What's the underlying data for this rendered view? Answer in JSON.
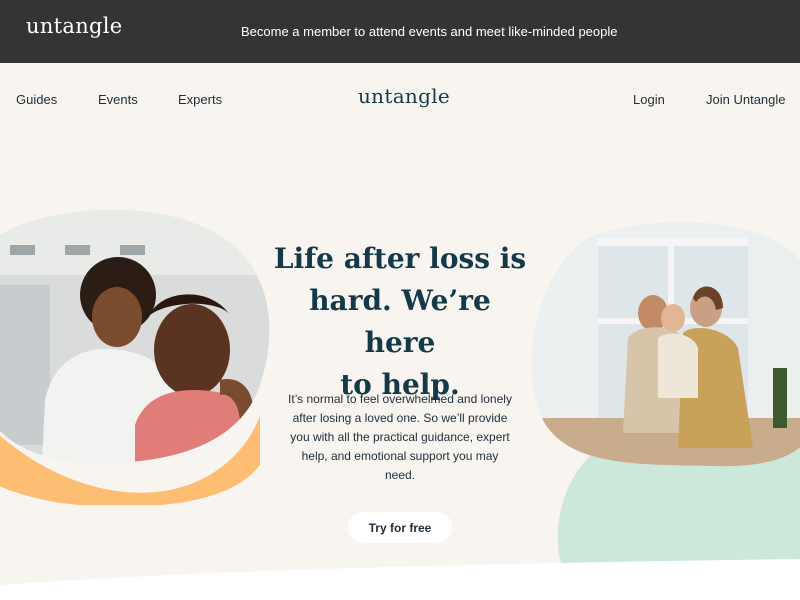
{
  "topbar": {
    "logo": "untangle",
    "promo": "Become a member to attend events and meet like-minded people"
  },
  "nav": {
    "links": [
      "Guides",
      "Events",
      "Experts"
    ],
    "brand": "untangle",
    "login": "Login",
    "join": "Join Untangle"
  },
  "hero": {
    "headline_lines": [
      "Life after loss is",
      "hard. We’re here",
      "to help."
    ],
    "body": "It’s normal to feel overwhelmed and lonely after losing a loved one. So we’ll provide you with all the practical guidance, expert help, and emotional support you may need.",
    "cta": "Try for free"
  },
  "colors": {
    "topbar": "#343434",
    "background": "#f8f5f1",
    "brand_teal": "#143a49",
    "accent_orange": "#fdbd72",
    "accent_mint": "#cce8da"
  }
}
